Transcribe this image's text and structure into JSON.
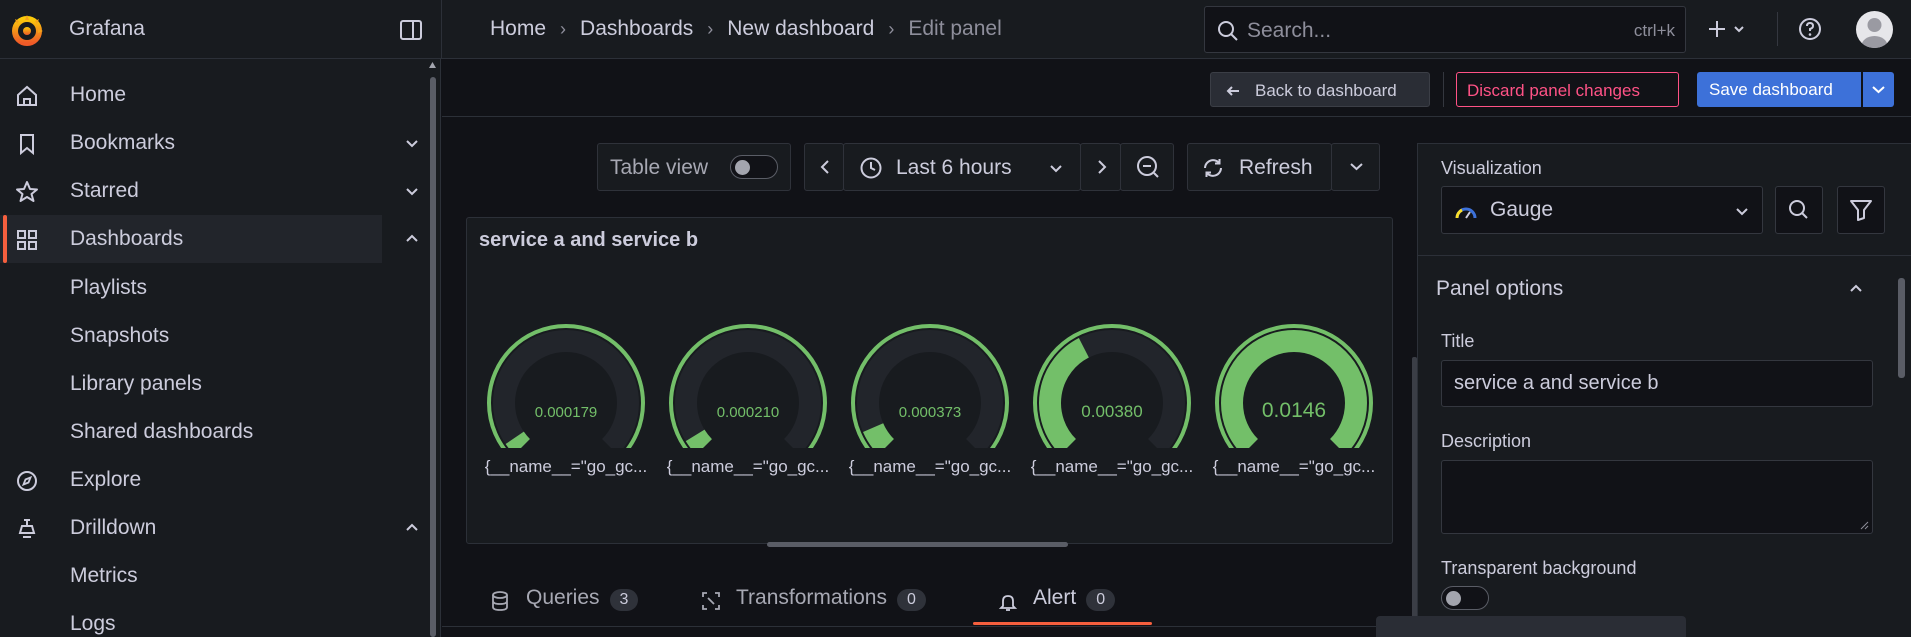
{
  "app": {
    "name": "Grafana"
  },
  "breadcrumbs": [
    "Home",
    "Dashboards",
    "New dashboard",
    "Edit panel"
  ],
  "search": {
    "placeholder": "Search...",
    "shortcut": "ctrl+k"
  },
  "sidebar": {
    "items": [
      {
        "label": "Home",
        "icon": "home-icon"
      },
      {
        "label": "Bookmarks",
        "icon": "bookmark-icon",
        "expand": "down"
      },
      {
        "label": "Starred",
        "icon": "star-icon",
        "expand": "down"
      },
      {
        "label": "Dashboards",
        "icon": "apps-icon",
        "expand": "up",
        "active": true
      },
      {
        "label": "Explore",
        "icon": "compass-icon"
      },
      {
        "label": "Drilldown",
        "icon": "drilldown-icon",
        "expand": "up"
      }
    ],
    "dashboard_children": [
      "Playlists",
      "Snapshots",
      "Library panels",
      "Shared dashboards"
    ],
    "drilldown_children": [
      "Metrics",
      "Logs"
    ]
  },
  "actions": {
    "back": "Back to dashboard",
    "discard": "Discard panel changes",
    "save": "Save dashboard"
  },
  "toolbar": {
    "table_view": "Table view",
    "time_range": "Last 6 hours",
    "refresh": "Refresh"
  },
  "panel": {
    "title": "service a and service b",
    "gauges": [
      {
        "value": "0.000179",
        "fraction": 0.04,
        "label": "{__name__=\"go_gc..."
      },
      {
        "value": "0.000210",
        "fraction": 0.05,
        "label": "{__name__=\"go_gc..."
      },
      {
        "value": "0.000373",
        "fraction": 0.08,
        "label": "{__name__=\"go_gc..."
      },
      {
        "value": "0.00380",
        "fraction": 0.4,
        "label": "{__name__=\"go_gc..."
      },
      {
        "value": "0.0146",
        "fraction": 1.0,
        "label": "{__name__=\"go_gc..."
      }
    ],
    "color_fill": "#73bf69",
    "color_track": "#22252b"
  },
  "query_tabs": [
    {
      "label": "Queries",
      "count": "3",
      "icon": "database-icon"
    },
    {
      "label": "Transformations",
      "count": "0",
      "icon": "transform-icon"
    },
    {
      "label": "Alert",
      "count": "0",
      "icon": "bell-icon",
      "active": true
    }
  ],
  "options": {
    "visualization_label": "Visualization",
    "visualization_value": "Gauge",
    "section": "Panel options",
    "title_label": "Title",
    "title_value": "service a and service b",
    "description_label": "Description",
    "transparent_label": "Transparent background"
  },
  "colors": {
    "accent": "#f55f3e",
    "primary": "#3d71d9",
    "danger": "#ff5286",
    "gauge_green": "#73bf69"
  }
}
